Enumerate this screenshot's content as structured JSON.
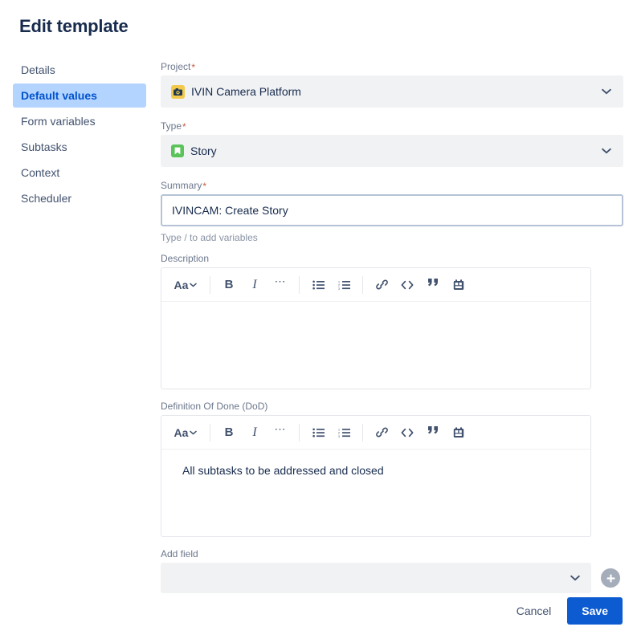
{
  "header": {
    "title": "Edit template"
  },
  "sidebar": {
    "items": [
      {
        "label": "Details",
        "active": false
      },
      {
        "label": "Default values",
        "active": true
      },
      {
        "label": "Form variables",
        "active": false
      },
      {
        "label": "Subtasks",
        "active": false
      },
      {
        "label": "Context",
        "active": false
      },
      {
        "label": "Scheduler",
        "active": false
      }
    ]
  },
  "form": {
    "project": {
      "label": "Project",
      "required_marker": "*",
      "value": "IVIN Camera Platform",
      "icon": "project-avatar-icon",
      "icon_color": "#F2C94C",
      "chevron": "chevron-down-icon"
    },
    "type": {
      "label": "Type",
      "required_marker": "*",
      "value": "Story",
      "icon": "story-type-icon",
      "icon_color": "#5AC45A",
      "chevron": "chevron-down-icon"
    },
    "summary": {
      "label": "Summary",
      "required_marker": "*",
      "value": "IVINCAM: Create Story",
      "placeholder": "",
      "helper": "Type / to add variables"
    },
    "description": {
      "label": "Description",
      "body": "",
      "delete_icon": "trash-icon"
    },
    "dod": {
      "label": "Definition Of Done (DoD)",
      "body": "All subtasks to be addressed and closed",
      "delete_icon": "trash-icon"
    },
    "add_field": {
      "label": "Add field",
      "value": "",
      "placeholder": "",
      "chevron": "chevron-down-icon",
      "add_button_icon": "plus-icon"
    }
  },
  "editor_toolbar": {
    "text_style_label": "Aa",
    "buttons": [
      {
        "name": "text-style-dropdown",
        "glyph": "Aa"
      },
      {
        "name": "bold-icon",
        "glyph": "B"
      },
      {
        "name": "italic-icon",
        "glyph": "I"
      },
      {
        "name": "more-formatting-icon",
        "glyph": "···"
      },
      {
        "name": "bullet-list-icon",
        "glyph": ""
      },
      {
        "name": "numbered-list-icon",
        "glyph": ""
      },
      {
        "name": "link-icon",
        "glyph": ""
      },
      {
        "name": "code-icon",
        "glyph": "<>"
      },
      {
        "name": "quote-icon",
        "glyph": "”"
      },
      {
        "name": "media-image-icon",
        "glyph": ""
      }
    ]
  },
  "footer": {
    "cancel_label": "Cancel",
    "save_label": "Save",
    "save_color": "#0C5BD0"
  }
}
